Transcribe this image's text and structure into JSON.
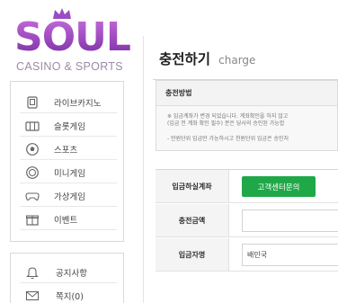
{
  "logo": {
    "word": "SOUL",
    "subtitle": "CASINO & SPORTS"
  },
  "sidebar": {
    "items": [
      {
        "label": "라이브카지노",
        "icon": "casino-card-icon"
      },
      {
        "label": "슬롯게임",
        "icon": "slot-machine-icon"
      },
      {
        "label": "스포츠",
        "icon": "soccer-ball-icon"
      },
      {
        "label": "미니게임",
        "icon": "chip-icon"
      },
      {
        "label": "가상게임",
        "icon": "gamepad-icon"
      },
      {
        "label": "이벤트",
        "icon": "gift-icon"
      }
    ],
    "items2": [
      {
        "label": "공지사항",
        "icon": "bell-icon"
      },
      {
        "label": "쪽지(0)",
        "icon": "envelope-icon"
      }
    ]
  },
  "main": {
    "title": "충전하기",
    "title_en": "charge",
    "method": {
      "heading": "충전방법",
      "line1": "※ 입금계좌가 변경 되었습니다. 계좌확인을 하지 않고",
      "line2": "(입금 전 계좌 확인 필수) 분은 당사의 승인된 가능합",
      "line3": "- 만원단위 입금만 가능하시고 천원단위 입금은 승인처"
    },
    "form": {
      "account_label": "입금하실계좌",
      "account_button": "고객센터문의",
      "amount_label": "충전금액",
      "amount_value": "",
      "name_label": "입금자명",
      "name_value": "배민국"
    }
  },
  "colors": {
    "brand_purple": "#8e3fb8",
    "button_green": "#20a848"
  }
}
